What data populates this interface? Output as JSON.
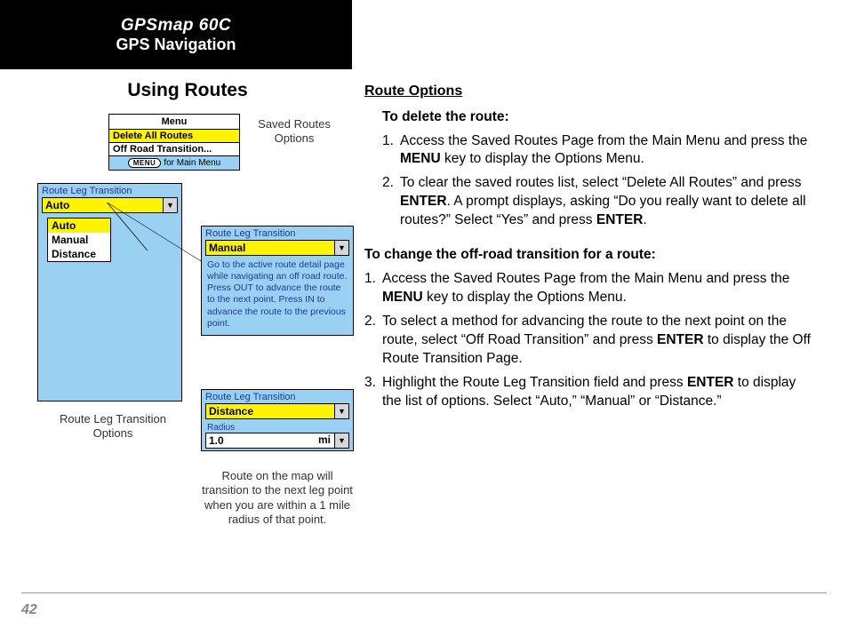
{
  "header": {
    "model": "GPSmap 60C",
    "section": "GPS Navigation"
  },
  "left": {
    "subtitle": "Using Routes",
    "options_menu": {
      "title": "Menu",
      "items": [
        "Delete All Routes",
        "Off Road Transition..."
      ],
      "footer_button": "MENU",
      "footer_text": "for Main Menu"
    },
    "auto_panel": {
      "title": "Route Leg Transition",
      "value": "Auto",
      "options": [
        "Auto",
        "Manual",
        "Distance"
      ]
    },
    "manual_panel": {
      "title": "Route Leg Transition",
      "value": "Manual",
      "desc": "Go to the active route detail page while navigating an off road route.  Press OUT to advance the route to the next point. Press IN to advance the route to the previous point."
    },
    "distance_panel": {
      "title": "Route Leg Transition",
      "value": "Distance",
      "radius_label": "Radius",
      "radius_value": "1.0",
      "radius_unit": "mi"
    },
    "callouts": {
      "saved": "Saved Routes Options",
      "rlopt": "Route Leg Transition Options",
      "radius": "Route on the map will transition to the next leg point when you are within a 1 mile radius of that point."
    }
  },
  "right": {
    "heading": "Route Options",
    "delete": {
      "sub": "To delete the route:",
      "steps": [
        "Access the Saved Routes Page from the Main Menu and press the <strong>MENU</strong> key to display the Options Menu.",
        "To clear the saved routes list, select “Delete All Routes” and press <strong>ENTER</strong>. A prompt displays, asking “Do you really want to delete all routes?”  Select “Yes” and press <strong>ENTER</strong>."
      ]
    },
    "change": {
      "sub": "To change the off-road transition for a route:",
      "steps": [
        "Access the Saved Routes Page from the Main Menu and press the <strong>MENU</strong> key to display the Options Menu.",
        "To select a method for advancing the route to the next point on the route, select “Off Road Transition” and press <strong>ENTER</strong> to display the Off Route Transition Page.",
        "Highlight the Route Leg Transition field and press <strong>ENTER</strong> to display the list of options. Select “Auto,” “Manual” or “Dis­tance.”"
      ]
    }
  },
  "page_number": "42"
}
